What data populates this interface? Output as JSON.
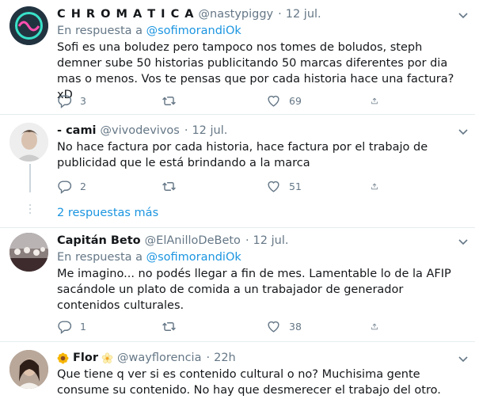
{
  "tweets": [
    {
      "name": "C H R O M A T I C A",
      "handle": "@nastypiggy",
      "date": "12 jul.",
      "reply_prefix": "En respuesta a",
      "reply_handle": "@sofimorandiOk",
      "text": "Sofi es una boludez pero tampoco nos tomes de boludos, steph demner sube 50 historias publicitando 50 marcas diferentes por dia mas o menos. Vos te pensas que por cada historia hace una factura? xD",
      "replies": "3",
      "retweets": "",
      "likes": "69"
    },
    {
      "name": "- cami",
      "handle": "@vivodevivos",
      "date": "12 jul.",
      "text": "No hace factura por cada historia, hace factura por el trabajo de publicidad que le está brindando a la marca",
      "replies": "2",
      "retweets": "",
      "likes": "51"
    },
    {
      "name": "Capitán Beto",
      "handle": "@ElAnilloDeBeto",
      "date": "12 jul.",
      "reply_prefix": "En respuesta a",
      "reply_handle": "@sofimorandiOk",
      "text": "Me imagino... no podés llegar a fin de mes. Lamentable lo de la AFIP sacándole un plato de comida a un trabajador de generador contenidos culturales.",
      "replies": "1",
      "retweets": "",
      "likes": "38"
    },
    {
      "name": "Flor",
      "handle": "@wayflorencia",
      "date": "22h",
      "text": "Que tiene q ver si es contenido cultural o no? Muchisima gente consume su contenido. No hay que desmerecer el trabajo del otro."
    }
  ],
  "more_replies": "2 respuestas más",
  "dot_sep": "·",
  "icons": [
    "reply-icon",
    "retweet-icon",
    "like-icon",
    "share-icon",
    "chevron-down-icon",
    "sunflower-emoji",
    "blossom-emoji"
  ],
  "colors": {
    "link": "#1b95e0",
    "muted": "#657786",
    "divider": "#e6ecf0"
  }
}
